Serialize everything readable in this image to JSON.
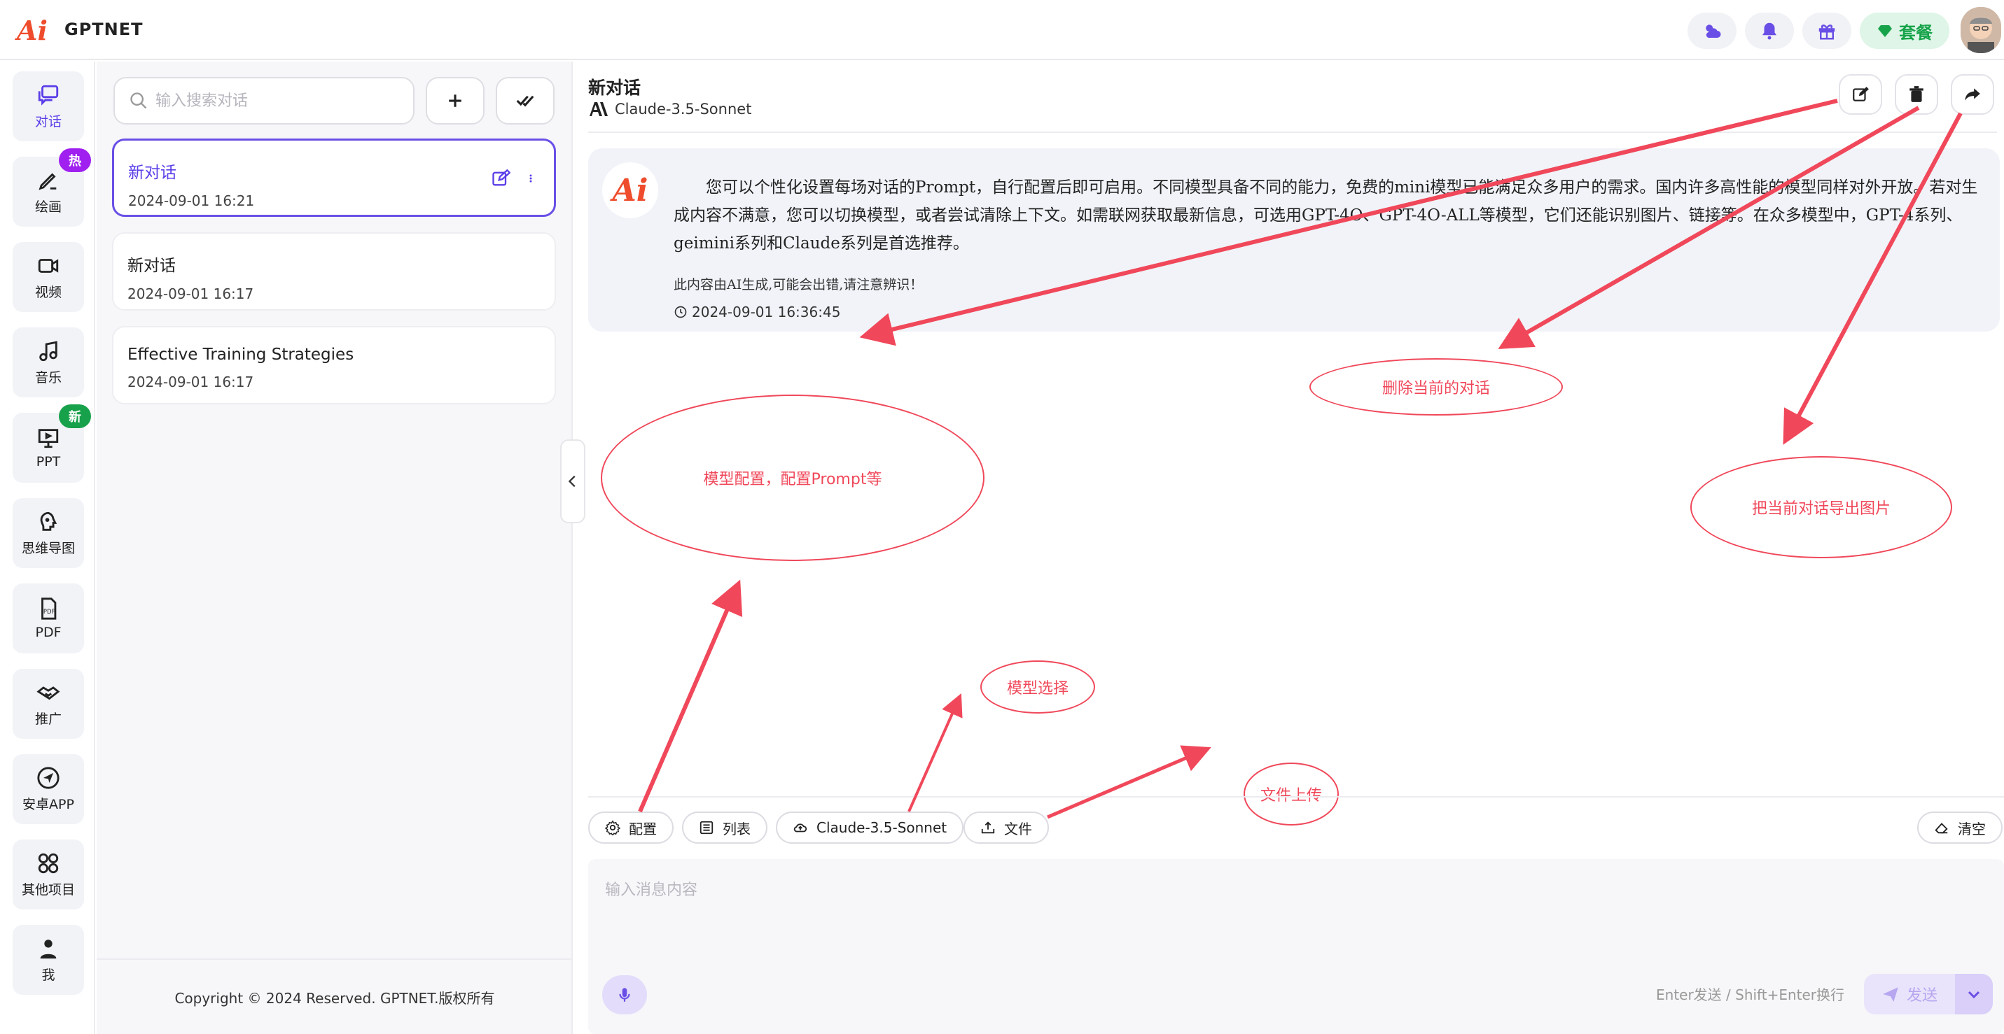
{
  "app": {
    "brand": "GPTNET",
    "logo_text": "Ai"
  },
  "topbar": {
    "plan_label": "套餐"
  },
  "nav": {
    "items": [
      {
        "label": "对话",
        "icon": "chat-icon",
        "active": true
      },
      {
        "label": "绘画",
        "icon": "brush-icon",
        "badge": "热"
      },
      {
        "label": "视频",
        "icon": "video-icon"
      },
      {
        "label": "音乐",
        "icon": "music-icon"
      },
      {
        "label": "PPT",
        "icon": "presentation-icon",
        "badge": "新"
      },
      {
        "label": "思维导图",
        "icon": "mindmap-icon"
      },
      {
        "label": "PDF",
        "icon": "pdf-icon"
      },
      {
        "label": "推广",
        "icon": "handshake-icon"
      },
      {
        "label": "安卓APP",
        "icon": "send-icon"
      },
      {
        "label": "其他项目",
        "icon": "grid-icon"
      },
      {
        "label": "我",
        "icon": "user-icon"
      }
    ]
  },
  "sidebar": {
    "search_placeholder": "输入搜索对话",
    "conversations": [
      {
        "title": "新对话",
        "date": "2024-09-01 16:21",
        "active": true
      },
      {
        "title": "新对话",
        "date": "2024-09-01 16:17"
      },
      {
        "title": "Effective Training Strategies",
        "date": "2024-09-01 16:17"
      }
    ],
    "copyright": "Copyright © 2024 Reserved. GPTNET.版权所有"
  },
  "chat": {
    "title": "新对话",
    "model": "Claude-3.5-Sonnet",
    "message": {
      "text": "您可以个性化设置每场对话的Prompt，自行配置后即可启用。不同模型具备不同的能力，免费的mini模型已能满足众多用户的需求。国内许多高性能的模型同样对外开放。若对生成内容不满意，您可以切换模型，或者尝试清除上下文。如需联网获取最新信息，可选用GPT-4O、GPT-4O-ALL等模型，它们还能识别图片、链接等。在众多模型中，GPT-4系列、geimini系列和Claude系列是首选推荐。",
      "note": "此内容由AI生成,可能会出错,请注意辨识！",
      "time": "2024-09-01 16:36:45"
    }
  },
  "annotations": {
    "delete": "删除当前的对话",
    "config": "模型配置，配置Prompt等",
    "export": "把当前对话导出图片",
    "model_select": "模型选择",
    "file_upload": "文件上传"
  },
  "toolbar": {
    "config": "配置",
    "list": "列表",
    "model": "Claude-3.5-Sonnet",
    "file": "文件",
    "clear": "清空"
  },
  "input": {
    "placeholder": "输入消息内容",
    "hint": "Enter发送 / Shift+Enter换行",
    "send": "发送"
  },
  "colors": {
    "accent": "#5b3ee8",
    "annotation": "#f0485a",
    "plan_green": "#17a34a",
    "hot_badge": "#a020f0",
    "new_badge": "#18a14b"
  }
}
